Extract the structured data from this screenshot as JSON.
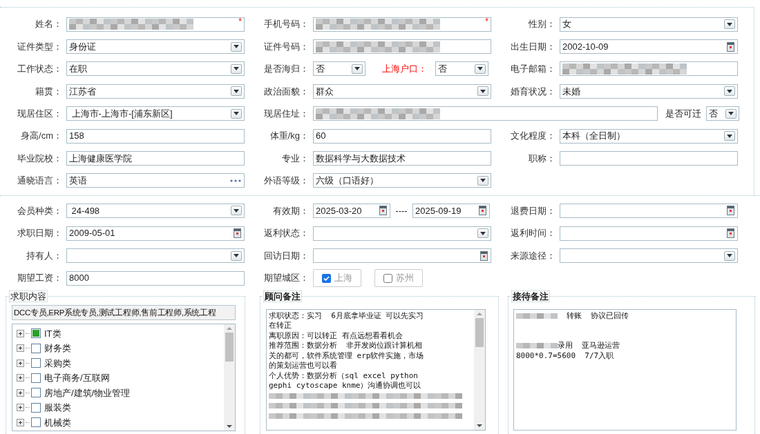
{
  "basic_info": {
    "rows": [
      {
        "cells": [
          {
            "label": "姓名：",
            "kind": "text",
            "masked": true,
            "mark": "*"
          },
          {
            "label": "手机号码：",
            "kind": "text",
            "masked": true,
            "mark": "*"
          },
          {
            "label": "性别：",
            "kind": "select",
            "value": "女"
          }
        ]
      },
      {
        "cells": [
          {
            "label": "证件类型：",
            "kind": "select",
            "value": "身份证"
          },
          {
            "label": "证件号码：",
            "kind": "text",
            "masked": true
          },
          {
            "label": "出生日期：",
            "kind": "date",
            "value": "2002-10-09"
          }
        ]
      },
      {
        "cells": [
          {
            "label": "工作状态：",
            "kind": "select",
            "value": "在职"
          },
          {
            "kind": "pair",
            "items": [
              {
                "label": "是否海归：",
                "value": "否",
                "highlight": false
              },
              {
                "label": "上海户口：",
                "value": "否",
                "highlight": true
              }
            ]
          },
          {
            "label": "电子邮箱：",
            "kind": "text",
            "masked": true
          }
        ]
      },
      {
        "cells": [
          {
            "label": "籍贯：",
            "kind": "select",
            "value": "江苏省"
          },
          {
            "label": "政治面貌：",
            "kind": "select",
            "value": "群众"
          },
          {
            "label": "婚育状况：",
            "kind": "select",
            "value": "未婚"
          }
        ]
      },
      {
        "cells": [
          {
            "label": "现居住区：",
            "kind": "select",
            "value": " 上海市-上海市-[浦东新区]"
          },
          {
            "label": "现居住址：",
            "kind": "address",
            "masked": true,
            "side": {
              "label": "是否可迁",
              "value": "否"
            }
          }
        ]
      },
      {
        "cells": [
          {
            "label": "身高/cm：",
            "kind": "text",
            "value": "158"
          },
          {
            "label": "体重/kg：",
            "kind": "text",
            "value": "60"
          },
          {
            "label": "文化程度：",
            "kind": "select",
            "value": "本科（全日制）"
          }
        ]
      },
      {
        "cells": [
          {
            "label": "毕业院校：",
            "kind": "text",
            "value": "上海健康医学院"
          },
          {
            "label": "专业：",
            "kind": "text",
            "value": "数据科学与大数据技术"
          },
          {
            "label": "职称：",
            "kind": "text"
          }
        ]
      },
      {
        "cells": [
          {
            "label": "通晓语言：",
            "kind": "more",
            "value": "英语"
          },
          {
            "label": "外语等级：",
            "kind": "select",
            "value": "六级（口语好）"
          }
        ]
      }
    ]
  },
  "membership": {
    "rows": [
      {
        "cells": [
          {
            "label": "会员种类：",
            "kind": "select",
            "value": " 24-498"
          },
          {
            "label": "有效期：",
            "kind": "range",
            "value": "2025-03-20",
            "separator": "----",
            "value_end": "2025-09-19"
          },
          {
            "label": "退费日期：",
            "kind": "date"
          }
        ]
      },
      {
        "cells": [
          {
            "label": "求职日期：",
            "kind": "date",
            "value": "2009-05-01"
          },
          {
            "label": "返利状态：",
            "kind": "select"
          },
          {
            "label": "返利时间：",
            "kind": "date"
          }
        ]
      },
      {
        "cells": [
          {
            "label": "持有人：",
            "kind": "select"
          },
          {
            "label": "回访日期：",
            "kind": "date"
          },
          {
            "label": "来源途径：",
            "kind": "select"
          }
        ]
      },
      {
        "cells": [
          {
            "label": "期望工资：",
            "kind": "text",
            "value": "8000"
          },
          {
            "label": "期望城区：",
            "kind": "checks",
            "options": [
              {
                "label": "上海",
                "checked": true
              },
              {
                "label": "苏州",
                "checked": false
              }
            ]
          }
        ]
      }
    ]
  },
  "job_content": {
    "title": "求职内容",
    "emphasis": false,
    "summary": "DCC专员,ERP系统专员,测试工程师,售前工程师,系统工程",
    "tree": [
      {
        "label": "IT类",
        "checked": true
      },
      {
        "label": "财务类",
        "checked": false
      },
      {
        "label": "采购类",
        "checked": false
      },
      {
        "label": "电子商务/互联网",
        "checked": false
      },
      {
        "label": "房地产/建筑/物业管理",
        "checked": false
      },
      {
        "label": "服装类",
        "checked": false
      },
      {
        "label": "机械类",
        "checked": false
      }
    ]
  },
  "consultant_notes": {
    "title": "顾问备注",
    "emphasis": true,
    "lines": [
      {
        "kind": "text",
        "text": "求职状态：实习  6月底拿毕业证 可以先实习"
      },
      {
        "kind": "text",
        "text": "在转正"
      },
      {
        "kind": "text",
        "text": "离职原因：可以转正 有点远想看看机会"
      },
      {
        "kind": "text",
        "text": "推荐范围：数据分析  非开发岗位跟计算机相"
      },
      {
        "kind": "text",
        "text": "关的都可，软件系统管理 erp软件实施，市场"
      },
      {
        "kind": "text",
        "text": "的策划运营也可以看"
      },
      {
        "kind": "text",
        "text": "个人优势：数据分析（sql excel python"
      },
      {
        "kind": "text",
        "text": "gephi cytoscape knme）沟通协调也可以"
      },
      {
        "kind": "masked"
      },
      {
        "kind": "masked"
      },
      {
        "kind": "masked"
      }
    ]
  },
  "reception_notes": {
    "title": "接待备注",
    "emphasis": true,
    "lines": [
      {
        "kind": "masked_prefix",
        "text": "  转账  协议已回传"
      },
      {
        "kind": "blank"
      },
      {
        "kind": "blank"
      },
      {
        "kind": "masked_prefix",
        "text": "录用  亚马逊运营"
      },
      {
        "kind": "text",
        "text": "8000*0.7=5600  7/7入职"
      }
    ]
  }
}
